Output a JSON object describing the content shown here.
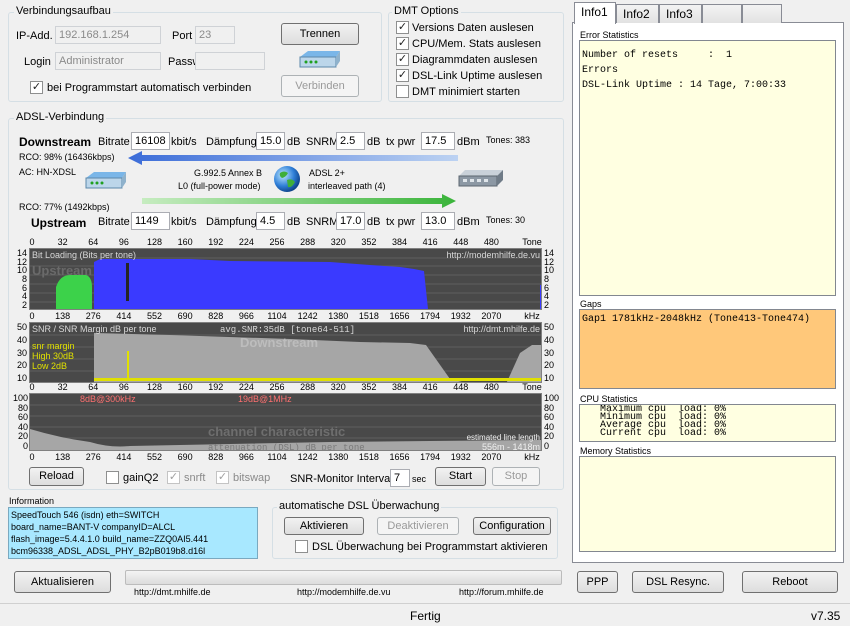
{
  "connection": {
    "title": "Verbindungsaufbau",
    "ip_label": "IP-Add.",
    "ip_value": "192.168.1.254",
    "port_label": "Port",
    "port_value": "23",
    "login_label": "Login",
    "login_value": "Administrator",
    "password_label": "Password",
    "password_value": "",
    "disconnect_btn": "Trennen",
    "connect_btn": "Verbinden",
    "autoconnect_label": "bei Programmstart automatisch verbinden",
    "autoconnect_checked": true
  },
  "dmt_options": {
    "title": "DMT Options",
    "items": [
      {
        "label": "Versions Daten auslesen",
        "checked": true
      },
      {
        "label": "CPU/Mem. Stats auslesen",
        "checked": true
      },
      {
        "label": "Diagrammdaten auslesen",
        "checked": true
      },
      {
        "label": "DSL-Link Uptime auslesen",
        "checked": true
      },
      {
        "label": "DMT minimiert starten",
        "checked": false
      }
    ]
  },
  "adsl": {
    "title": "ADSL-Verbindung",
    "downstream": {
      "label": "Downstream",
      "bitrate_label": "Bitrate",
      "bitrate": "16108",
      "bitrate_unit": "kbit/s",
      "damp_label": "Dämpfung",
      "damp": "15.0",
      "damp_unit": "dB",
      "snrm_label": "SNRM",
      "snrm": "2.5",
      "snrm_unit": "dB",
      "txpwr_label": "tx pwr",
      "txpwr": "17.5",
      "txpwr_unit": "dBm",
      "tones": "Tones: 383"
    },
    "upstream": {
      "label": "Upstream",
      "bitrate_label": "Bitrate",
      "bitrate": "1149",
      "bitrate_unit": "kbit/s",
      "damp_label": "Dämpfung",
      "damp": "4.5",
      "damp_unit": "dB",
      "snrm_label": "SNRM",
      "snrm": "17.0",
      "snrm_unit": "dB",
      "txpwr_label": "tx pwr",
      "txpwr": "13.0",
      "txpwr_unit": "dBm",
      "tones": "Tones: 30"
    },
    "rco_down": "RCO: 98% (16436kbps)",
    "ac": "AC: HN-XDSL",
    "rco_up": "RCO: 77% (1492kbps)",
    "mode1": "G.992.5 Annex B",
    "mode2": "L0 (full-power mode)",
    "mode3": "ADSL 2+",
    "mode4": "interleaved path (4)"
  },
  "graphs": {
    "tone_ticks": [
      "0",
      "32",
      "64",
      "96",
      "128",
      "160",
      "192",
      "224",
      "256",
      "288",
      "320",
      "352",
      "384",
      "416",
      "448",
      "480",
      "Tone"
    ],
    "khz_ticks": [
      "0",
      "138",
      "276",
      "414",
      "552",
      "690",
      "828",
      "966",
      "1104",
      "1242",
      "1380",
      "1518",
      "1656",
      "1794",
      "1932",
      "2070",
      "kHz"
    ],
    "bit_yticks": [
      "14",
      "12",
      "10",
      "8",
      "6",
      "4",
      "2"
    ],
    "snr_yticks": [
      "50",
      "40",
      "30",
      "20",
      "10"
    ],
    "att_yticks": [
      "100",
      "80",
      "60",
      "40",
      "20",
      "0"
    ],
    "bit_title": "Bit Loading (Bits per tone)",
    "bit_url": "http://modemhilfe.de.vu",
    "bit_watermark": "Upstream",
    "snr_title": "SNR / SNR Margin  dB per tone",
    "snr_avg": "avg.SNR:35dB  [tone64-511]",
    "snr_url": "http://dmt.mhilfe.de",
    "snr_watermark": "Downstream",
    "snr_legend1": "snr margin",
    "snr_legend2": "High 30dB",
    "snr_legend3": "Low  2dB",
    "att_label1": "8dB@300kHz",
    "att_label2": "19dB@1MHz",
    "att_watermark": "channel characteristic",
    "att_caption": "attenuation (DSL) dB per tone",
    "att_length_label": "estimated line length",
    "att_length": "556m - 1418m",
    "colors": {
      "bits": "#3a3aff",
      "upstream": "#3cd24a",
      "snr": "#a6a6a6",
      "margin": "#e0e000",
      "graph_bg": "#494949"
    }
  },
  "controls": {
    "reload": "Reload",
    "gainq2": "gainQ2",
    "gainq2_checked": false,
    "snrft": "snrft",
    "snrft_checked": true,
    "bitswap": "bitswap",
    "bitswap_checked": true,
    "snr_interval_label": "SNR-Monitor Interval:",
    "snr_interval": "7",
    "sec": "sec",
    "start": "Start",
    "stop": "Stop"
  },
  "information": {
    "title": "Information",
    "lines": [
      "SpeedTouch 546 (isdn) eth=SWITCH",
      "board_name=BANT-V   companyID=ALCL",
      "flash_image=5.4.4.1.0  build_name=ZZQ0AI5.441",
      "bcm96338_ADSL_ADSL_PHY_B2pB019b8.d16l"
    ]
  },
  "monitor": {
    "title": "automatische DSL Überwachung",
    "activate": "Aktivieren",
    "deactivate": "Deaktivieren",
    "config": "Configuration",
    "startup_label": "DSL Überwachung bei Programmstart aktivieren",
    "startup_checked": false
  },
  "bottom": {
    "refresh": "Aktualisieren",
    "link1": "http://dmt.mhilfe.de",
    "link2": "http://modemhilfe.de.vu",
    "link3": "http://forum.mhilfe.de",
    "ppp": "PPP",
    "resync": "DSL Resync.",
    "reboot": "Reboot"
  },
  "status": {
    "text": "Fertig",
    "version": "v7.35"
  },
  "right": {
    "tabs": [
      "Info1",
      "Info2",
      "Info3",
      "",
      ""
    ],
    "error_title": "Error Statistics",
    "error_lines": [
      "Number of resets     :  1",
      "Errors",
      "DSL-Link Uptime : 14 Tage, 7:00:33"
    ],
    "gaps_title": "Gaps",
    "gaps_lines": [
      "Gap1 1781kHz-2048kHz (Tone413-Tone474)"
    ],
    "cpu_title": "CPU Statistics",
    "cpu_lines": [
      "   Maximum cpu  load: 0%",
      "   Minimum cpu  load: 0%",
      "   Average cpu  load: 0%",
      "   Current cpu  load: 0%"
    ],
    "mem_title": "Memory Statistics"
  }
}
